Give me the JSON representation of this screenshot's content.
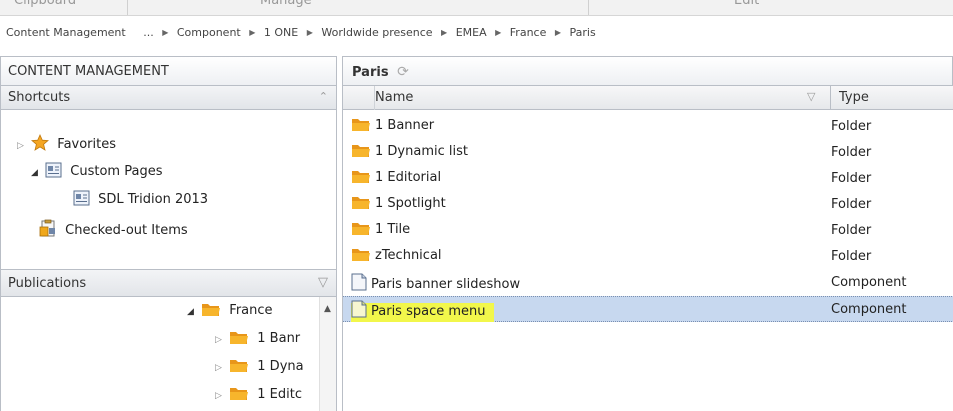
{
  "toolbar": {
    "groups": [
      "Clipboard",
      "Manage",
      "Edit"
    ]
  },
  "breadcrumb": {
    "root": "Content Management",
    "items": [
      "...",
      "Component",
      "1 ONE",
      "Worldwide presence",
      "EMEA",
      "France",
      "Paris"
    ]
  },
  "left_panel": {
    "title": "CONTENT MANAGEMENT",
    "shortcuts": {
      "label": "Shortcuts",
      "items": [
        "Favorites",
        "Custom Pages",
        "SDL Tridion 2013",
        "Checked-out Items"
      ]
    },
    "publications": {
      "label": "Publications",
      "items": [
        "France",
        "1 Banr",
        "1 Dyna",
        "1 Editc"
      ]
    }
  },
  "main": {
    "title": "Paris",
    "columns": {
      "name": "Name",
      "type": "Type"
    },
    "rows": [
      {
        "name": "1 Banner",
        "type": "Folder"
      },
      {
        "name": "1 Dynamic list",
        "type": "Folder"
      },
      {
        "name": "1 Editorial",
        "type": "Folder"
      },
      {
        "name": "1 Spotlight",
        "type": "Folder"
      },
      {
        "name": "1 Tile",
        "type": "Folder"
      },
      {
        "name": "zTechnical",
        "type": "Folder"
      },
      {
        "name": "Paris banner slideshow",
        "type": "Component"
      },
      {
        "name": "Paris space menu",
        "type": "Component"
      }
    ]
  },
  "colors": {
    "selection": "#c7d8ef",
    "highlight": "#f2f74b",
    "folder": "#f0a81c",
    "star": "#f5a623",
    "border": "#b9bec6"
  },
  "icons": {
    "folder": "folder-icon",
    "component": "component-icon",
    "star": "star-icon",
    "custom_page": "custom-page-icon",
    "checked_out": "checked-out-icon",
    "refresh": "refresh-icon",
    "filter": "filter-icon"
  }
}
